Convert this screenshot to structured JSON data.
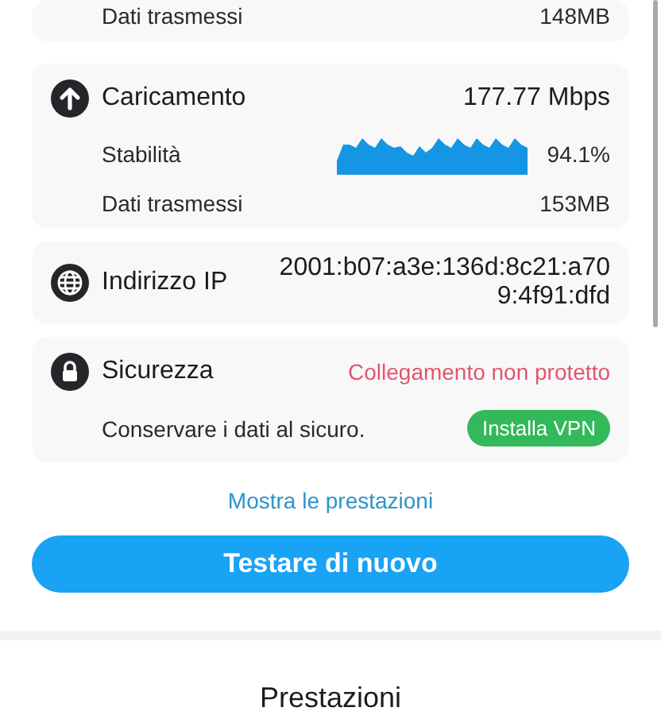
{
  "download_tail": {
    "rows": [
      {
        "label": "Dati trasmessi",
        "value": "148MB"
      }
    ]
  },
  "upload": {
    "title": "Caricamento",
    "speed": "177.77 Mbps",
    "rows": [
      {
        "kind": "stability",
        "label": "Stabilità",
        "value": "94.1%"
      },
      {
        "kind": "plain",
        "label": "Dati trasmessi",
        "value": "153MB"
      }
    ]
  },
  "ip": {
    "title": "Indirizzo IP",
    "value_lines": [
      "2001:b07:a3e:136d:8c21:a70",
      "9:4f91:dfd"
    ]
  },
  "security": {
    "title": "Sicurezza",
    "status": "Collegamento non protetto",
    "protected": false,
    "note": "Conservare i dati al sicuro.",
    "action": "Installa VPN"
  },
  "link": "Mostra le prestazioni",
  "retest_button": "Testare di nuovo",
  "section_title": "Prestazioni"
}
